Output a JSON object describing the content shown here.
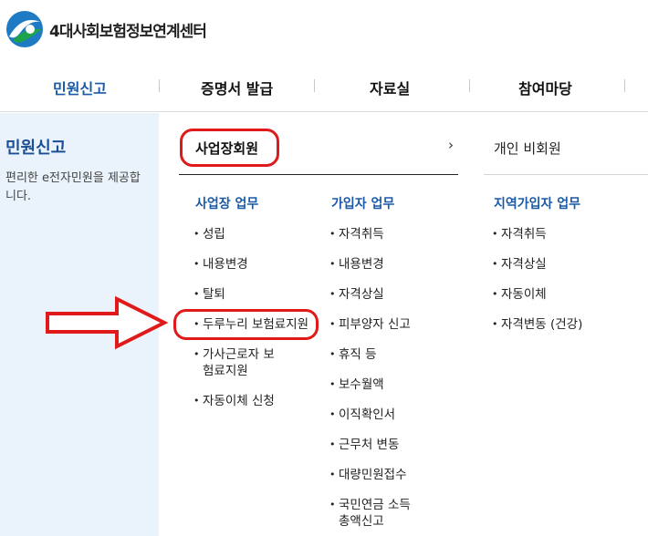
{
  "header": {
    "site_name": "4대사회보험정보연계센터"
  },
  "nav": {
    "items": [
      {
        "label": "민원신고",
        "active": true
      },
      {
        "label": "증명서 발급",
        "active": false
      },
      {
        "label": "자료실",
        "active": false
      },
      {
        "label": "참여마당",
        "active": false
      }
    ]
  },
  "sidebar": {
    "title": "민원신고",
    "description": "편리한 e전자민원을 제공합니다."
  },
  "member_tabs": {
    "business": "사업장회원",
    "individual": "개인 비회원"
  },
  "columns": {
    "business": {
      "heading": "사업장 업무",
      "items": [
        "성립",
        "내용변경",
        "탈퇴",
        "두루누리 보험료지원",
        "가사근로자 보험료지원",
        "자동이체 신청"
      ]
    },
    "subscriber": {
      "heading": "가입자 업무",
      "items": [
        "자격취득",
        "내용변경",
        "자격상실",
        "피부양자 신고",
        "휴직 등",
        "보수월액",
        "이직확인서",
        "근무처 변동",
        "대량민원접수",
        "국민연금 소득총액신고"
      ]
    },
    "regional": {
      "heading": "지역가입자 업무",
      "items": [
        "자격취득",
        "자격상실",
        "자동이체",
        "자격변동 (건강)"
      ]
    }
  },
  "colors": {
    "accent_blue": "#1a5aa6",
    "annotation_red": "#e01a1a",
    "sidebar_bg": "#eaf3fb"
  }
}
